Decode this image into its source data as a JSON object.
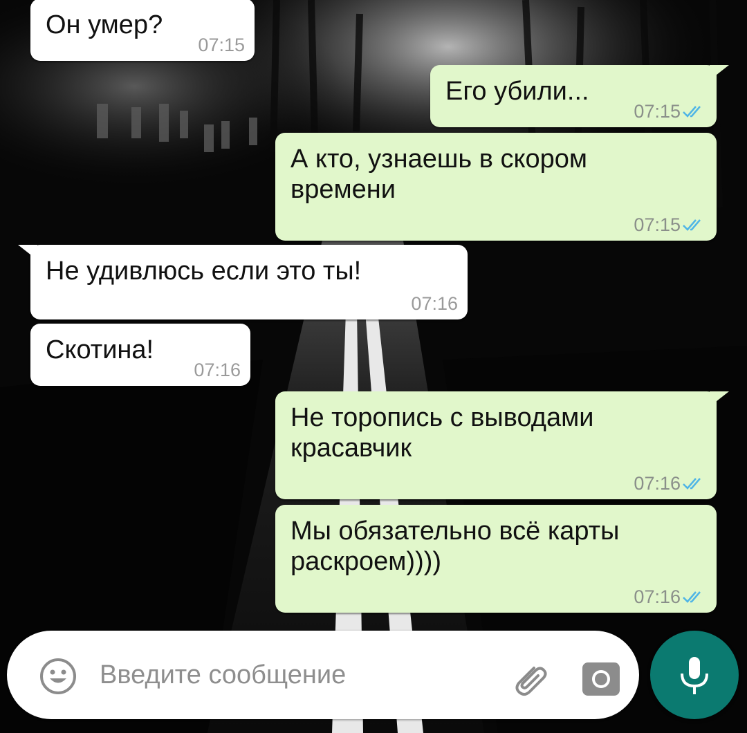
{
  "colors": {
    "incoming_bubble": "#ffffff",
    "outgoing_bubble": "#e1f7cb",
    "read_ticks": "#4fb5e6",
    "mic_button": "#0b7a70",
    "timestamp": "#8a8f8a"
  },
  "messages": [
    {
      "direction": "incoming",
      "text": "Он умер?",
      "time": "07:15"
    },
    {
      "direction": "outgoing",
      "text": "Его убили...",
      "time": "07:15",
      "status": "read"
    },
    {
      "direction": "outgoing",
      "text": "А кто, узнаешь в скором\nвремени",
      "time": "07:15",
      "status": "read"
    },
    {
      "direction": "incoming",
      "text": "Не удивлюсь если это ты!",
      "time": "07:16"
    },
    {
      "direction": "incoming",
      "text": "Скотина!",
      "time": "07:16"
    },
    {
      "direction": "outgoing",
      "text": "Не торопись с выводами\nкрасавчик",
      "time": "07:16",
      "status": "read"
    },
    {
      "direction": "outgoing",
      "text": "Мы обязательно всё карты\nраскроем))))",
      "time": "07:16",
      "status": "read"
    }
  ],
  "composer": {
    "placeholder": "Введите сообщение",
    "value": "",
    "icons": [
      "emoji-icon",
      "paperclip-icon",
      "camera-icon",
      "microphone-icon"
    ]
  }
}
